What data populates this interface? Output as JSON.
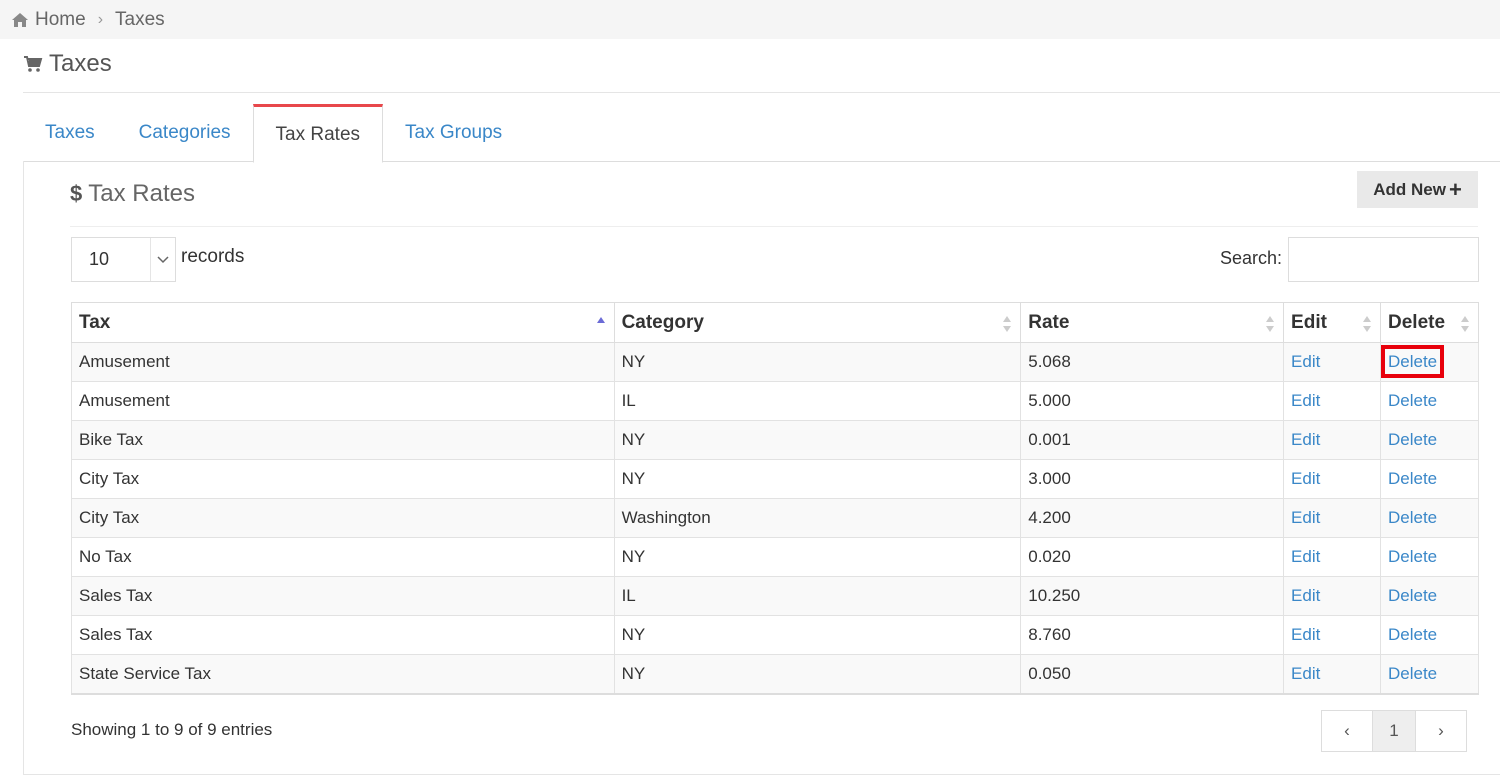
{
  "breadcrumb": {
    "home": "Home",
    "current": "Taxes"
  },
  "page_title": "Taxes",
  "tabs": [
    {
      "label": "Taxes",
      "active": false
    },
    {
      "label": "Categories",
      "active": false
    },
    {
      "label": "Tax Rates",
      "active": true
    },
    {
      "label": "Tax Groups",
      "active": false
    }
  ],
  "section": {
    "title": "Tax Rates",
    "add_new_label": "Add New"
  },
  "records": {
    "value": "10",
    "label": "records"
  },
  "search": {
    "label": "Search:",
    "value": ""
  },
  "table": {
    "columns": [
      "Tax",
      "Category",
      "Rate",
      "Edit",
      "Delete"
    ],
    "rows": [
      {
        "tax": "Amusement",
        "category": "NY",
        "rate": "5.068",
        "edit": "Edit",
        "delete": "Delete"
      },
      {
        "tax": "Amusement",
        "category": "IL",
        "rate": "5.000",
        "edit": "Edit",
        "delete": "Delete"
      },
      {
        "tax": "Bike Tax",
        "category": "NY",
        "rate": "0.001",
        "edit": "Edit",
        "delete": "Delete"
      },
      {
        "tax": "City Tax",
        "category": "NY",
        "rate": "3.000",
        "edit": "Edit",
        "delete": "Delete"
      },
      {
        "tax": "City Tax",
        "category": "Washington",
        "rate": "4.200",
        "edit": "Edit",
        "delete": "Delete"
      },
      {
        "tax": "No Tax",
        "category": "NY",
        "rate": "0.020",
        "edit": "Edit",
        "delete": "Delete"
      },
      {
        "tax": "Sales Tax",
        "category": "IL",
        "rate": "10.250",
        "edit": "Edit",
        "delete": "Delete"
      },
      {
        "tax": "Sales Tax",
        "category": "NY",
        "rate": "8.760",
        "edit": "Edit",
        "delete": "Delete"
      },
      {
        "tax": "State Service Tax",
        "category": "NY",
        "rate": "0.050",
        "edit": "Edit",
        "delete": "Delete"
      }
    ]
  },
  "footer": {
    "showing": "Showing 1 to 9 of 9 entries",
    "prev": "‹",
    "page": "1",
    "next": "›"
  },
  "colors": {
    "link": "#3a87c8",
    "active_tab_accent": "#e8474b",
    "highlight": "#e8000b"
  },
  "icons": {
    "home": "home-icon",
    "cart": "cart-icon",
    "dollar": "dollar-icon",
    "plus": "plus-icon"
  }
}
